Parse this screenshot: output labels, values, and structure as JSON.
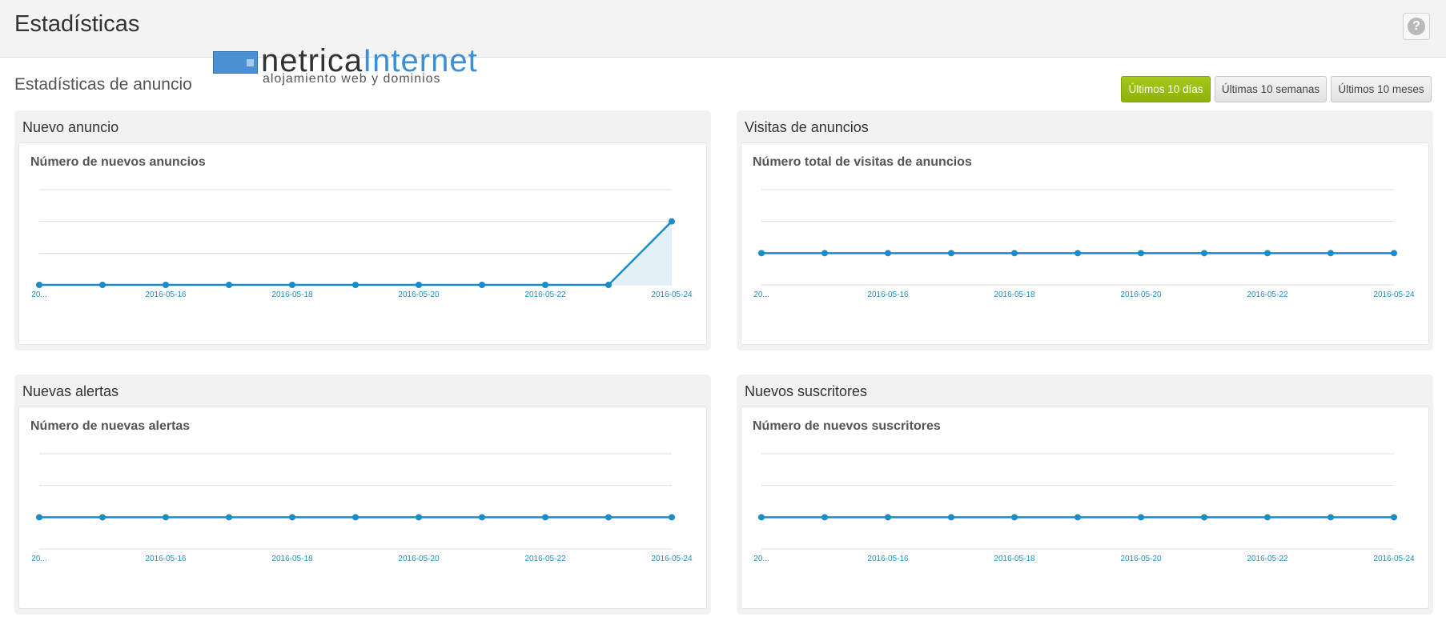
{
  "header": {
    "title": "Estadísticas",
    "help_symbol": "?"
  },
  "section": {
    "title": "Estadísticas de anuncio"
  },
  "logo": {
    "word_a": "netrica",
    "word_b": "Internet",
    "tagline": "alojamiento web y dominios"
  },
  "range_buttons": [
    {
      "label": "Últimos 10 días",
      "active": true
    },
    {
      "label": "Últimas 10 semanas",
      "active": false
    },
    {
      "label": "Últimos 10 meses",
      "active": false
    }
  ],
  "colors": {
    "line": "#1b8cc8",
    "area": "#e3f0f8",
    "grid": "#dddddd",
    "active_button": "#9abc12"
  },
  "panels": [
    {
      "title": "Nuevo anuncio",
      "chart_data": {
        "type": "area",
        "title": "Número de nuevos anuncios",
        "x": [
          "2016-05-14",
          "2016-05-15",
          "2016-05-16",
          "2016-05-17",
          "2016-05-18",
          "2016-05-19",
          "2016-05-20",
          "2016-05-21",
          "2016-05-22",
          "2016-05-23",
          "2016-05-24"
        ],
        "x_tick_labels": [
          "20...",
          "2016-05-16",
          "2016-05-18",
          "2016-05-20",
          "2016-05-22",
          "2016-05-24"
        ],
        "values": [
          0,
          0,
          0,
          0,
          0,
          0,
          0,
          0,
          0,
          0,
          2
        ],
        "ylim": [
          0,
          3
        ],
        "grid": true,
        "filled": true
      }
    },
    {
      "title": "Visitas de anuncios",
      "chart_data": {
        "type": "line",
        "title": "Número total de visitas de anuncios",
        "x": [
          "2016-05-14",
          "2016-05-15",
          "2016-05-16",
          "2016-05-17",
          "2016-05-18",
          "2016-05-19",
          "2016-05-20",
          "2016-05-21",
          "2016-05-22",
          "2016-05-23",
          "2016-05-24"
        ],
        "x_tick_labels": [
          "20...",
          "2016-05-16",
          "2016-05-18",
          "2016-05-20",
          "2016-05-22",
          "2016-05-24"
        ],
        "values": [
          0,
          0,
          0,
          0,
          0,
          0,
          0,
          0,
          0,
          0,
          0
        ],
        "ylim": [
          -1,
          2
        ],
        "grid": true,
        "filled": false
      }
    },
    {
      "title": "Nuevas alertas",
      "chart_data": {
        "type": "line",
        "title": "Número de nuevas alertas",
        "x": [
          "2016-05-14",
          "2016-05-15",
          "2016-05-16",
          "2016-05-17",
          "2016-05-18",
          "2016-05-19",
          "2016-05-20",
          "2016-05-21",
          "2016-05-22",
          "2016-05-23",
          "2016-05-24"
        ],
        "x_tick_labels": [
          "20...",
          "2016-05-16",
          "2016-05-18",
          "2016-05-20",
          "2016-05-22",
          "2016-05-24"
        ],
        "values": [
          0,
          0,
          0,
          0,
          0,
          0,
          0,
          0,
          0,
          0,
          0
        ],
        "ylim": [
          -1,
          2
        ],
        "grid": true,
        "filled": false
      }
    },
    {
      "title": "Nuevos suscritores",
      "chart_data": {
        "type": "line",
        "title": "Número de nuevos suscritores",
        "x": [
          "2016-05-14",
          "2016-05-15",
          "2016-05-16",
          "2016-05-17",
          "2016-05-18",
          "2016-05-19",
          "2016-05-20",
          "2016-05-21",
          "2016-05-22",
          "2016-05-23",
          "2016-05-24"
        ],
        "x_tick_labels": [
          "20...",
          "2016-05-16",
          "2016-05-18",
          "2016-05-20",
          "2016-05-22",
          "2016-05-24"
        ],
        "values": [
          0,
          0,
          0,
          0,
          0,
          0,
          0,
          0,
          0,
          0,
          0
        ],
        "ylim": [
          -1,
          2
        ],
        "grid": true,
        "filled": false
      }
    }
  ]
}
